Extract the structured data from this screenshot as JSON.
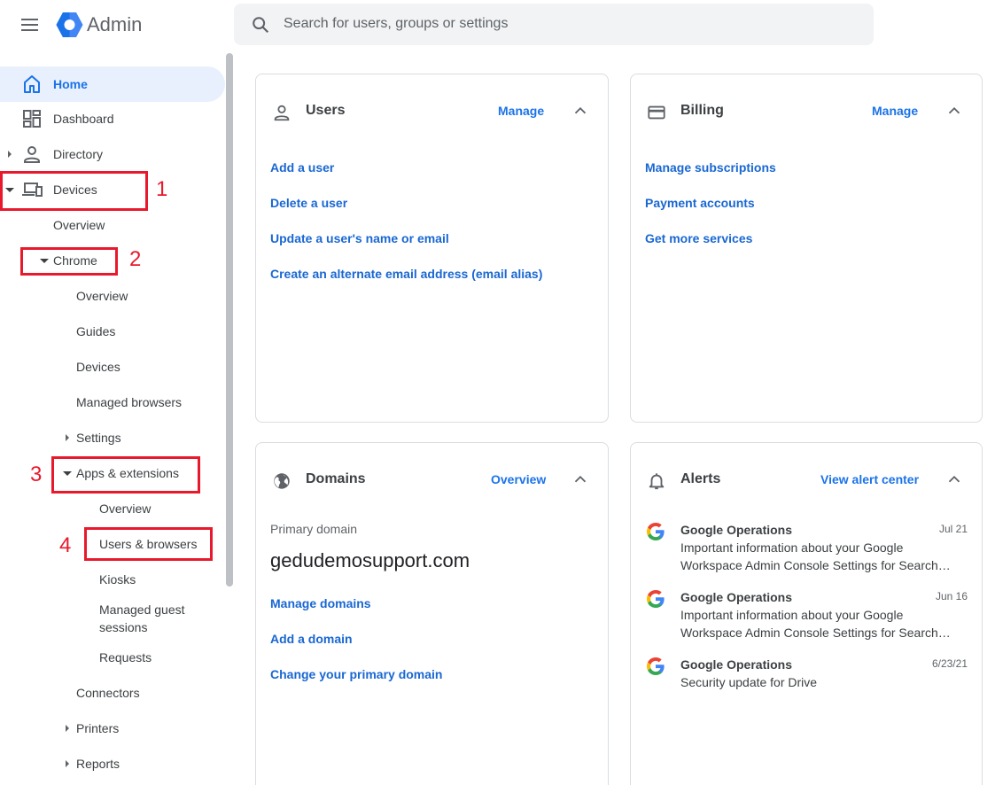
{
  "header": {
    "app_title": "Admin",
    "search_placeholder": "Search for users, groups or settings"
  },
  "sidebar": {
    "home": "Home",
    "dashboard": "Dashboard",
    "directory": "Directory",
    "devices": "Devices",
    "devices_overview": "Overview",
    "chrome": "Chrome",
    "chrome_overview": "Overview",
    "guides": "Guides",
    "chrome_devices": "Devices",
    "managed_browsers": "Managed browsers",
    "settings": "Settings",
    "apps_extensions": "Apps & extensions",
    "apps_overview": "Overview",
    "users_browsers": "Users & browsers",
    "kiosks": "Kiosks",
    "managed_guest_1": "Managed guest",
    "managed_guest_2": "sessions",
    "requests": "Requests",
    "connectors": "Connectors",
    "printers": "Printers",
    "reports": "Reports"
  },
  "annotations": {
    "step1": "1",
    "step2": "2",
    "step3": "3",
    "step4": "4",
    "highlight_color": "#e8192c"
  },
  "cards": {
    "users": {
      "title": "Users",
      "action": "Manage",
      "links": [
        "Add a user",
        "Delete a user",
        "Update a user's name or email",
        "Create an alternate email address (email alias)"
      ]
    },
    "billing": {
      "title": "Billing",
      "action": "Manage",
      "links": [
        "Manage subscriptions",
        "Payment accounts",
        "Get more services"
      ]
    },
    "domains": {
      "title": "Domains",
      "action": "Overview",
      "primary_label": "Primary domain",
      "primary_domain": "gedudemosupport.com",
      "links": [
        "Manage domains",
        "Add a domain",
        "Change your primary domain"
      ]
    },
    "alerts": {
      "title": "Alerts",
      "action": "View alert center",
      "items": [
        {
          "title": "Google Operations",
          "date": "Jul 21",
          "line1": "Important information about your Google",
          "line2": "Workspace Admin Console Settings for Search…"
        },
        {
          "title": "Google Operations",
          "date": "Jun 16",
          "line1": "Important information about your Google",
          "line2": "Workspace Admin Console Settings for Search…"
        },
        {
          "title": "Google Operations",
          "date": "6/23/21",
          "line1": "Security update for Drive",
          "line2": ""
        }
      ]
    }
  },
  "colors": {
    "accent": "#1a73e8",
    "active_bg": "#e8f0fe",
    "card_border": "#dadce0"
  }
}
